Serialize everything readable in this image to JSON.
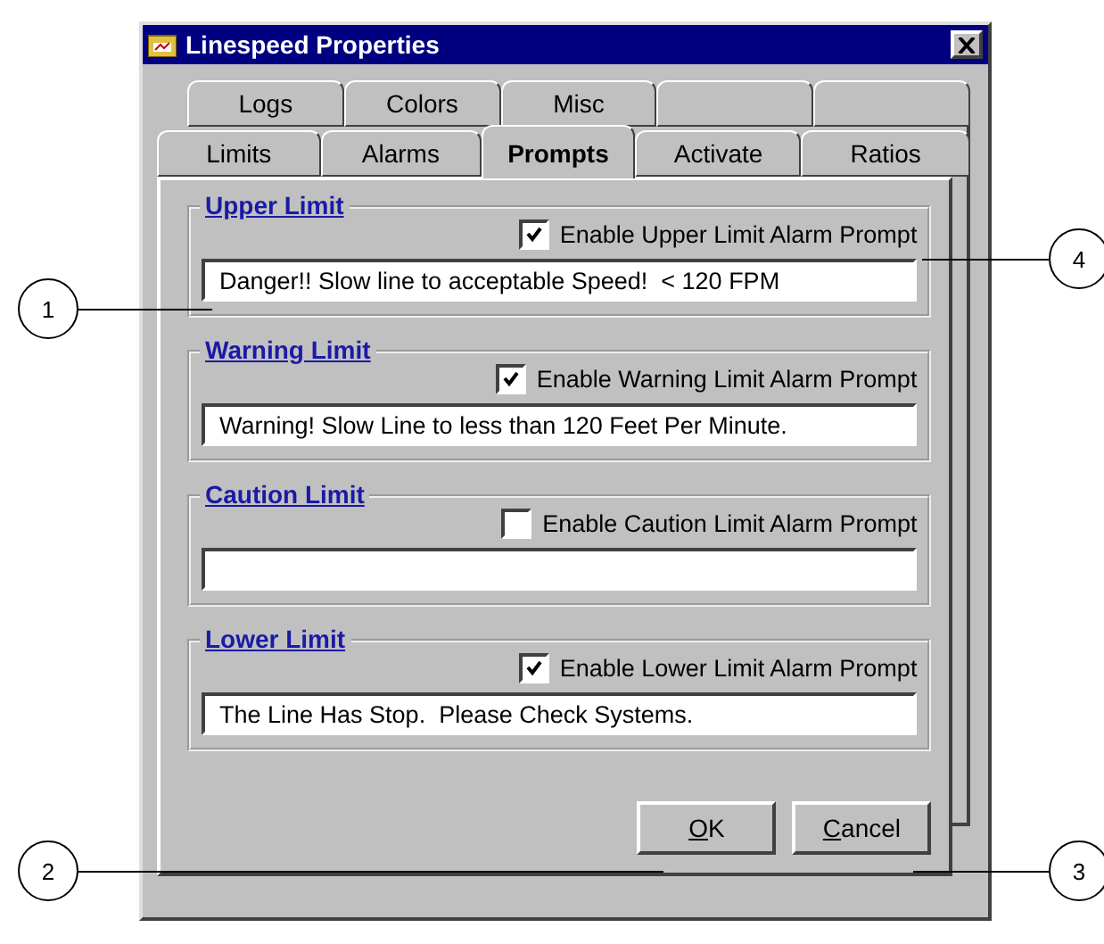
{
  "window": {
    "title": "Linespeed Properties"
  },
  "tab_rows": [
    {
      "tabs": [
        {
          "label": "Logs",
          "selected": false,
          "kind": "text"
        },
        {
          "label": "Colors",
          "selected": false,
          "kind": "text"
        },
        {
          "label": "Misc",
          "selected": false,
          "kind": "text"
        },
        {
          "selected": false,
          "kind": "blank"
        },
        {
          "selected": false,
          "kind": "blank"
        }
      ]
    },
    {
      "tabs": [
        {
          "label": "Limits",
          "selected": false,
          "kind": "text"
        },
        {
          "label": "Alarms",
          "selected": false,
          "kind": "text"
        },
        {
          "label": "Prompts",
          "selected": true,
          "kind": "text"
        },
        {
          "label": "Activate",
          "selected": false,
          "kind": "text"
        },
        {
          "label": "Ratios",
          "selected": false,
          "kind": "text"
        }
      ]
    }
  ],
  "groups": [
    {
      "title": "Upper Limit",
      "checkbox_label": "Enable Upper Limit Alarm Prompt",
      "checked": true,
      "value": "Danger!! Slow line to acceptable Speed!  < 120 FPM"
    },
    {
      "title": "Warning Limit",
      "checkbox_label": "Enable Warning Limit Alarm Prompt",
      "checked": true,
      "value": "Warning! Slow Line to less than 120 Feet Per Minute."
    },
    {
      "title": "Caution Limit",
      "checkbox_label": "Enable Caution Limit Alarm Prompt",
      "checked": false
    },
    {
      "title": "Lower Limit",
      "checkbox_label": "Enable Lower Limit Alarm Prompt",
      "checked": true,
      "value": "The Line Has Stop.  Please Check Systems."
    }
  ],
  "buttons": [
    "OK",
    "Cancel"
  ],
  "callouts": [
    {
      "number": "4"
    },
    {
      "number": "1"
    },
    {
      "number": "2"
    },
    {
      "number": "3"
    }
  ]
}
